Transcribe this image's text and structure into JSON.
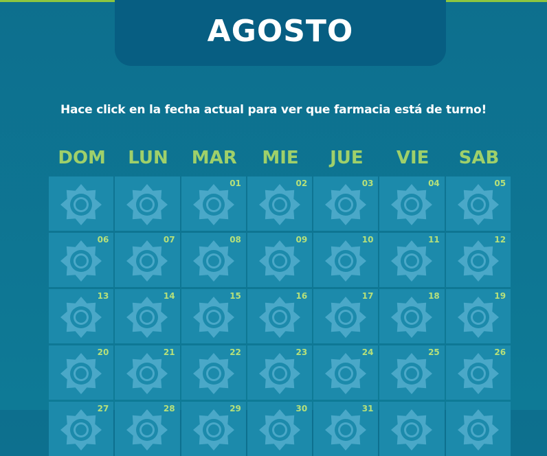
{
  "header": {
    "month": "AGOSTO"
  },
  "instruction": "Hace click en la fecha actual para ver que farmacia está de turno!",
  "weekdays": [
    "DOM",
    "LUN",
    "MAR",
    "MIE",
    "JUE",
    "VIE",
    "SAB"
  ],
  "days": [
    "",
    "",
    "01",
    "02",
    "03",
    "04",
    "05",
    "06",
    "07",
    "08",
    "09",
    "10",
    "11",
    "12",
    "13",
    "14",
    "15",
    "16",
    "17",
    "18",
    "19",
    "20",
    "21",
    "22",
    "23",
    "24",
    "25",
    "26",
    "27",
    "28",
    "29",
    "30",
    "31",
    "",
    ""
  ],
  "colors": {
    "background": "#0e7a96",
    "header": "#075e82",
    "accent": "#8dc63f",
    "weekday": "#9fd06a",
    "cell": "#1c8aab",
    "icon": "#4aa8c8"
  },
  "icons": {
    "cell_icon": "sun-icon"
  }
}
